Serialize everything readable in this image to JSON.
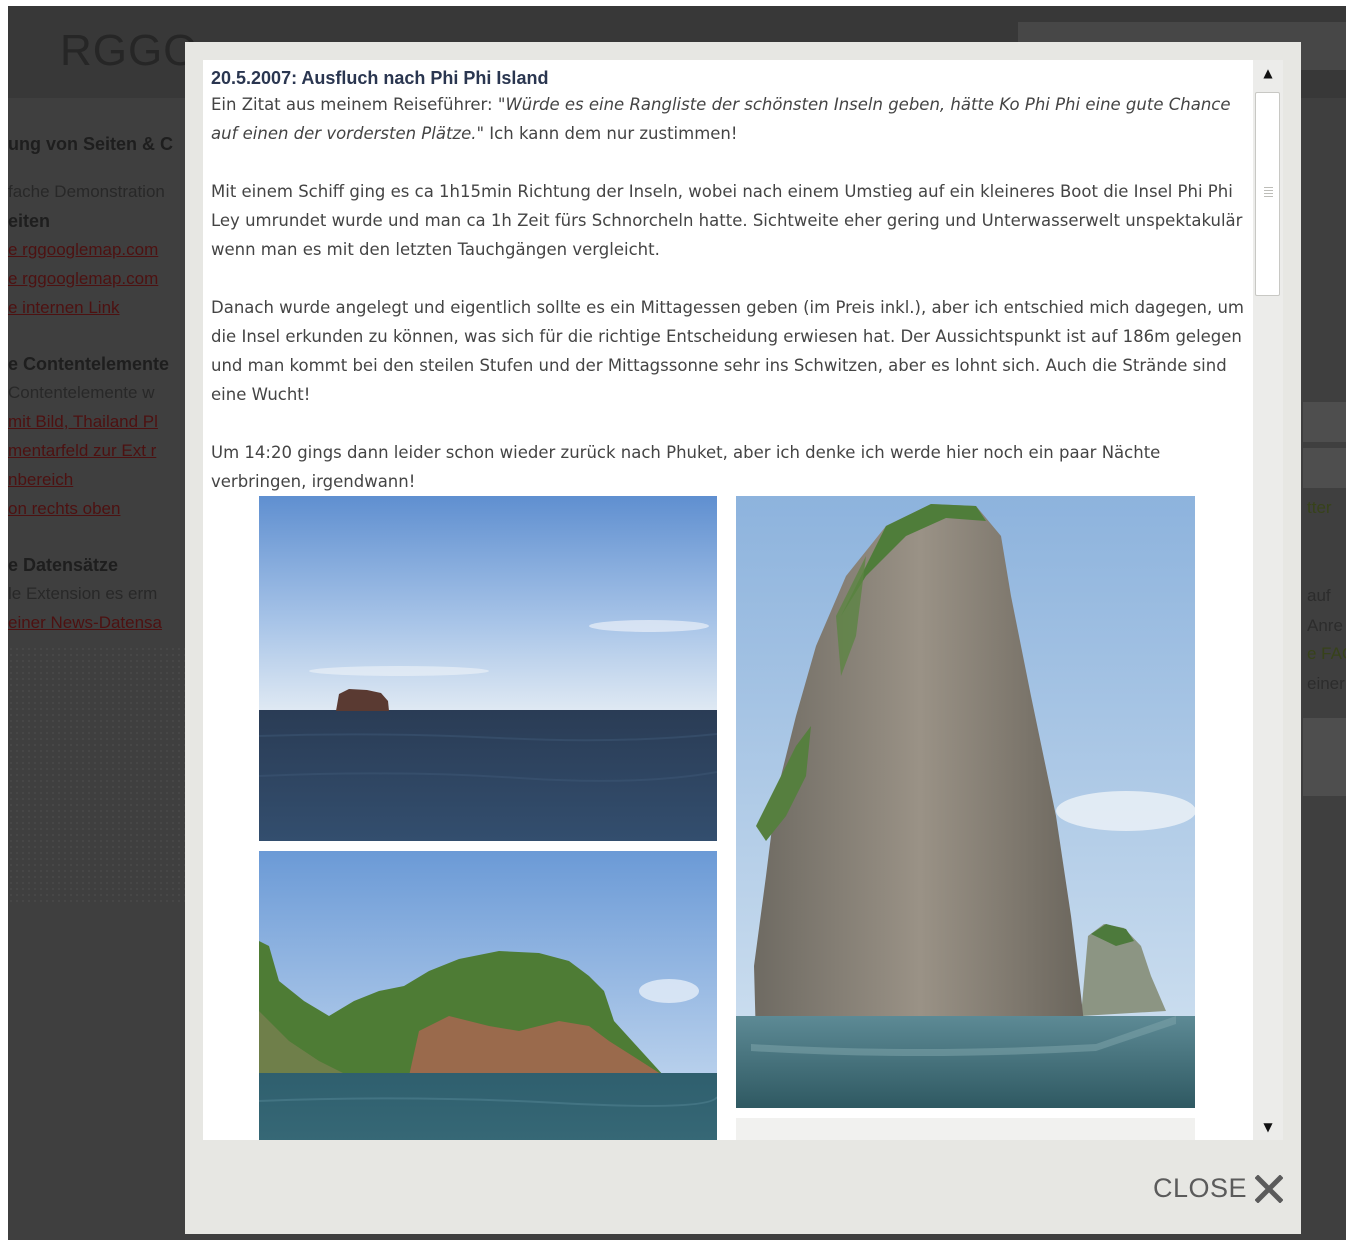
{
  "background": {
    "logo": "RGGO",
    "left_items": [
      {
        "kind": "heading",
        "text": "ung von Seiten & C"
      },
      {
        "kind": "text",
        "text": "fache Demonstration"
      },
      {
        "kind": "heading",
        "text": "eiten"
      },
      {
        "kind": "link",
        "text": "e rggooglemap.com"
      },
      {
        "kind": "link",
        "text": "e rggooglemap.com"
      },
      {
        "kind": "link",
        "text": "e internen Link"
      },
      {
        "kind": "heading",
        "text": "e Contentelemente"
      },
      {
        "kind": "text",
        "text": "Contentelemente w"
      },
      {
        "kind": "link",
        "text": "mit Bild, Thailand Pl"
      },
      {
        "kind": "link",
        "text": "mentarfeld zur Ext r"
      },
      {
        "kind": "link",
        "text": "nbereich"
      },
      {
        "kind": "link",
        "text": "on rechts oben"
      },
      {
        "kind": "heading",
        "text": "e Datensätze"
      },
      {
        "kind": "text",
        "text": "le Extension es erm"
      },
      {
        "kind": "link",
        "text": "einer News-Datensa"
      }
    ],
    "right_items": [
      {
        "kind": "link",
        "text": "tter"
      },
      {
        "kind": "text",
        "text": "auf"
      },
      {
        "kind": "text",
        "text": "Anre"
      },
      {
        "kind": "link",
        "text": "e FAQ"
      },
      {
        "kind": "text",
        "text": "einer"
      }
    ]
  },
  "lightbox": {
    "title": "20.5.2007: Ausfluch nach Phi Phi Island",
    "intro_prefix": "Ein Zitat aus meinem Reiseführer: \"",
    "intro_quote": "Würde es eine Rangliste der schönsten Inseln geben, hätte Ko Phi Phi eine gute Chance auf einen der vordersten Plätze.",
    "intro_suffix": "\" Ich kann dem nur zustimmen!",
    "paragraphs": [
      "Mit einem Schiff ging es ca 1h15min Richtung der Inseln, wobei nach einem Umstieg auf ein kleineres Boot die Insel Phi Phi Ley umrundet wurde und man ca 1h Zeit fürs Schnorcheln hatte. Sichtweite eher gering und Unterwasserwelt unspektakulär wenn man es mit den letzten Tauchgängen vergleicht.",
      "Danach wurde angelegt und eigentlich sollte es ein Mittagessen geben (im Preis inkl.), aber ich entschied mich dagegen, um die Insel erkunden zu können, was sich für die richtige Entscheidung erwiesen hat. Der Aussichtspunkt ist auf 186m gelegen und man kommt bei den steilen Stufen und der Mittagssonne sehr ins Schwitzen, aber es lohnt sich. Auch die Strände sind eine Wucht!",
      "Um 14:20 gings dann leider schon wieder zurück nach Phuket, aber ich denke ich werde hier noch ein paar Nächte verbringen, irgendwann!"
    ],
    "photos": [
      {
        "name": "photo-small-rock-island"
      },
      {
        "name": "photo-tall-limestone-rock"
      },
      {
        "name": "photo-green-island"
      }
    ],
    "close_label": "CLOSE"
  }
}
